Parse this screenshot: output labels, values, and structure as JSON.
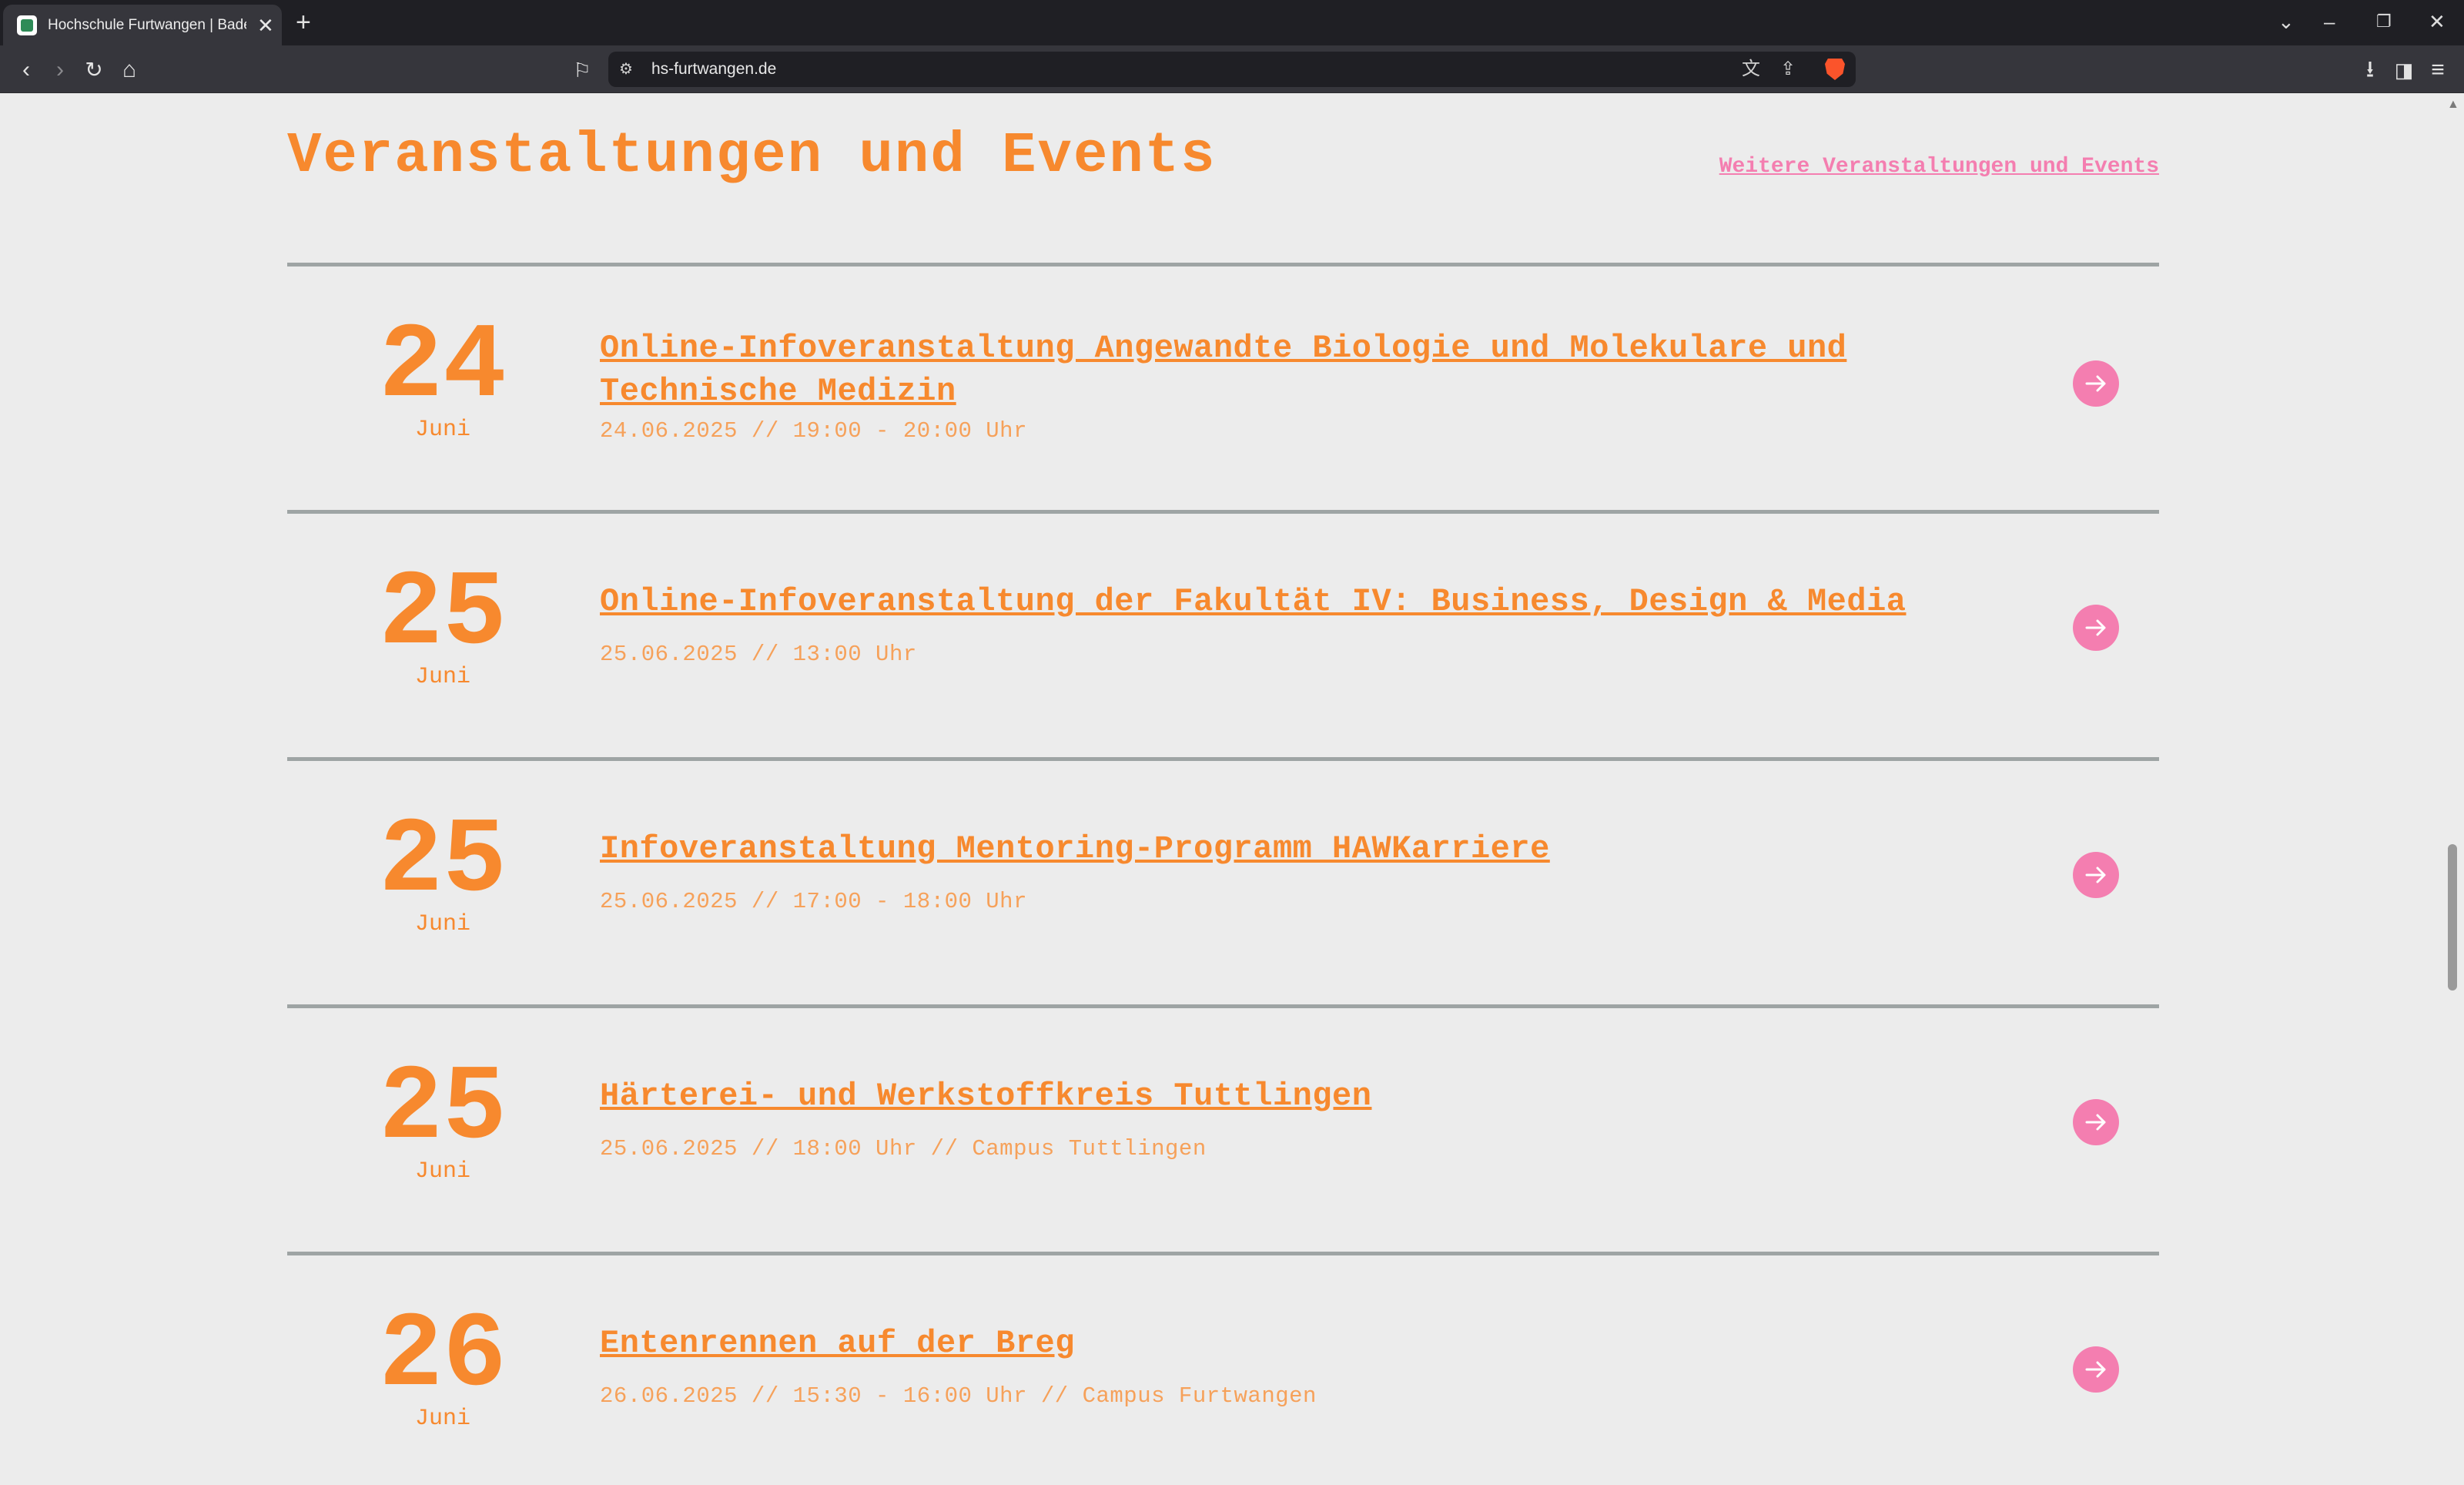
{
  "browser": {
    "tab_title": "Hochschule Furtwangen | Baden-Württemberg",
    "url": "hs-furtwangen.de"
  },
  "section": {
    "heading": "Veranstaltungen und Events",
    "more_link": "Weitere Veranstaltungen und Events"
  },
  "events": [
    {
      "day": "24",
      "month": "Juni",
      "title": "Online-Infoveranstaltung Angewandte Biologie und Molekulare und Technische Medizin",
      "meta": "24.06.2025 // 19:00 - 20:00 Uhr"
    },
    {
      "day": "25",
      "month": "Juni",
      "title": "Online-Infoveranstaltung der Fakultät IV: Business, Design & Media",
      "meta": "25.06.2025 // 13:00 Uhr"
    },
    {
      "day": "25",
      "month": "Juni",
      "title": "Infoveranstaltung Mentoring-Programm HAWKarriere",
      "meta": "25.06.2025 // 17:00 - 18:00 Uhr"
    },
    {
      "day": "25",
      "month": "Juni",
      "title": "Härterei- und Werkstoffkreis Tuttlingen",
      "meta": "25.06.2025 // 18:00 Uhr // Campus Tuttlingen"
    },
    {
      "day": "26",
      "month": "Juni",
      "title": "Entenrennen auf der Breg",
      "meta": "26.06.2025 // 15:30 - 16:00 Uhr // Campus Furtwangen"
    }
  ],
  "colors": {
    "accent_orange": "#f7892e",
    "accent_pink": "#f47eb0",
    "divider": "#9ea4a4",
    "background": "#ececec"
  },
  "icons": {
    "event_link": "arrow-right-icon"
  }
}
